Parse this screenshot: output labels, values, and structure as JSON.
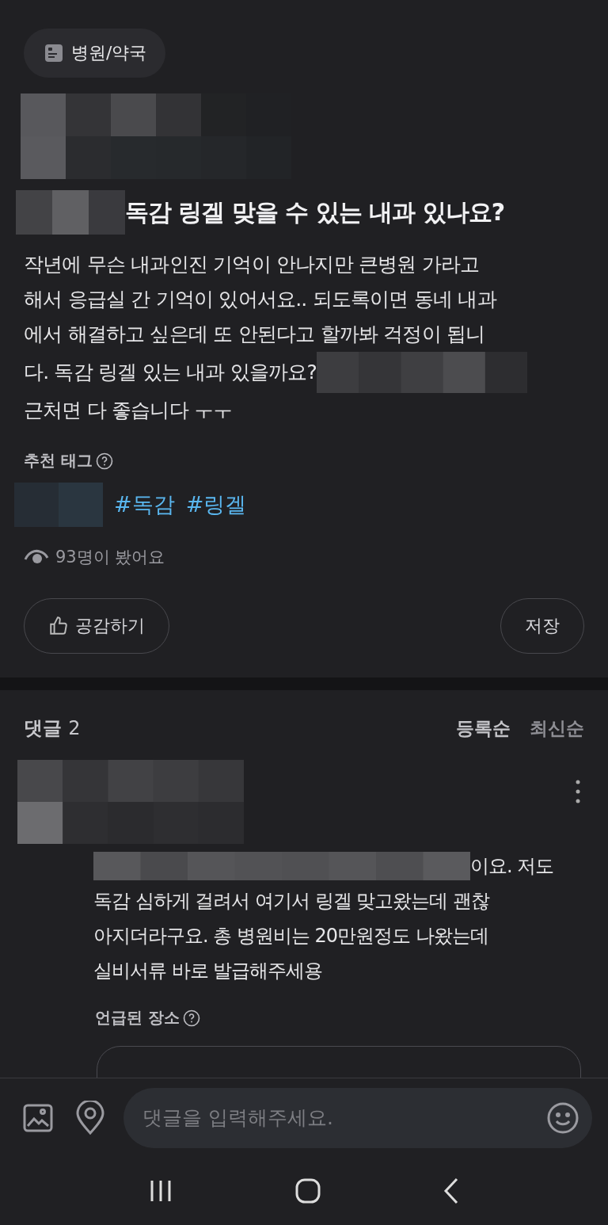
{
  "post": {
    "category": "병원/약국",
    "title": "독감 링겔 맞을 수 있는 내과 있나요?",
    "body": [
      "작년에 무슨 내과인진 기억이 안나지만 큰병원 가라고",
      "해서 응급실 간 기억이 있어서요.. 되도록이면 동네 내과",
      "에서 해결하고 싶은데 또 안된다고 할까봐 걱정이 됩니",
      "다. 독감 링겔 있는 내과 있을까요?",
      "근처면 다 좋습니다 ㅜㅜ"
    ],
    "tags_label": "추천 태그",
    "tags": [
      "#독감",
      "#링겔"
    ],
    "views": "93명이 봤어요",
    "like_button": "공감하기",
    "save_button": "저장"
  },
  "comments": {
    "label": "댓글",
    "count": "2",
    "sort": [
      {
        "label": "등록순",
        "selected": true
      },
      {
        "label": "최신순",
        "selected": false
      }
    ],
    "items": [
      {
        "text": [
          "이요. 저도",
          "독감 심하게 걸려서 여기서 링겔 맞고왔는데 괜찮",
          "아지더라구요. 총 병원비는 20만원정도 나왔는데",
          "실비서류 바로 발급해주세용"
        ],
        "places_label": "언급된 장소"
      }
    ]
  },
  "input": {
    "placeholder": "댓글을 입력해주세요."
  }
}
